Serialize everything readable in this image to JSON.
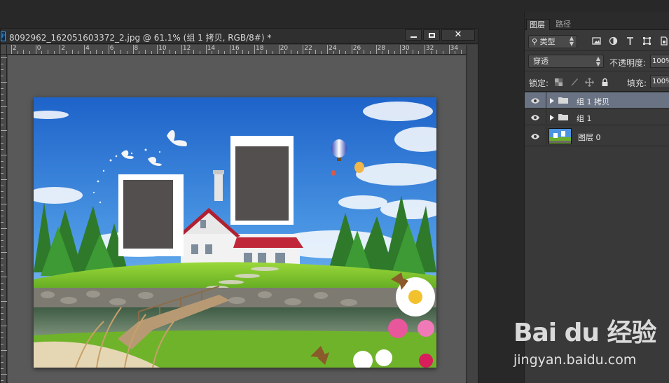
{
  "document": {
    "title": "8092962_162051603372_2.jpg @ 61.1% (组 1 拷贝, RGB/8#) *",
    "app_badge": "Ps",
    "ruler_labels": [
      "2",
      "0",
      "2",
      "4",
      "6",
      "8",
      "10",
      "12",
      "14",
      "16",
      "18",
      "20",
      "22",
      "24",
      "26",
      "28",
      "30",
      "32",
      "34"
    ]
  },
  "window_buttons": {
    "minimize": "minimize",
    "maximize": "maximize",
    "close": "close"
  },
  "panel": {
    "tabs": [
      "图层",
      "路径"
    ],
    "filter_label": "类型",
    "filter_icons": [
      "image-filter-icon",
      "adjustment-filter-icon",
      "text-filter-icon",
      "shape-filter-icon",
      "smart-object-filter-icon"
    ],
    "blend_mode": "穿透",
    "opacity_label": "不透明度:",
    "opacity_value": "100%",
    "lock_label": "锁定:",
    "fill_label": "填充:",
    "fill_value": "100%",
    "layers": [
      {
        "name": "组 1 拷贝",
        "type": "group",
        "selected": true
      },
      {
        "name": "组 1",
        "type": "group",
        "selected": false
      },
      {
        "name": "图层 0",
        "type": "image",
        "selected": false
      }
    ]
  },
  "watermark": {
    "logo": "Bai du 经验",
    "url": "jingyan.baidu.com"
  }
}
